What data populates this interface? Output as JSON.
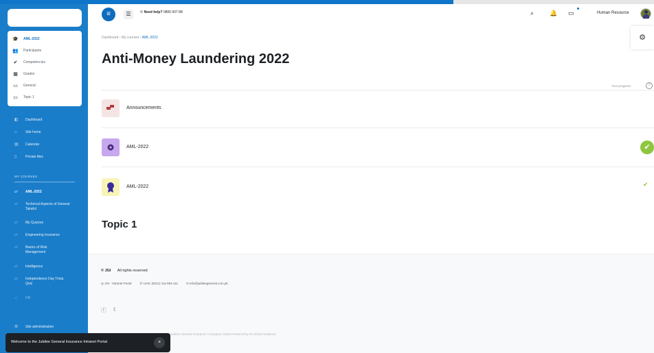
{
  "topbar": {
    "help_label": "Need help?",
    "help_phone": "0800 007 88",
    "user_name": "Human Resource",
    "icons": [
      "menu-icon",
      "list-icon",
      "phone-icon",
      "search-icon",
      "bell-icon",
      "chat-icon"
    ]
  },
  "course_index": [
    {
      "label": "AML-2022",
      "icon": "graduation-cap-icon",
      "active": true
    },
    {
      "label": "Participants",
      "icon": "users-icon"
    },
    {
      "label": "Competencies",
      "icon": "check-icon"
    },
    {
      "label": "Grades",
      "icon": "grades-icon"
    },
    {
      "label": "General",
      "icon": "folder-icon"
    },
    {
      "label": "Topic 1",
      "icon": "folder-icon"
    }
  ],
  "nav": [
    {
      "label": "Dashboard",
      "icon": "dashboard-icon"
    },
    {
      "label": "Site home",
      "icon": "home-icon"
    },
    {
      "label": "Calendar",
      "icon": "calendar-icon"
    },
    {
      "label": "Private files",
      "icon": "file-icon"
    }
  ],
  "my_courses": {
    "heading": "MY COURSES",
    "items": [
      {
        "label": "AML-2022",
        "active": true
      },
      {
        "label": "Technical Aspects of General Takaful"
      },
      {
        "label": "My Quizzes"
      },
      {
        "label": "Engineering Insurance"
      },
      {
        "label": "Basics of Risk Management"
      },
      {
        "label": "Intelligence"
      },
      {
        "label": "Independence Day Trivia Quiz"
      },
      {
        "label": "HR"
      }
    ]
  },
  "site_admin": "Site administration",
  "breadcrumb": {
    "items": [
      "Dashboard",
      "My courses",
      "AML-2022"
    ],
    "separator": "›"
  },
  "page_title": "Anti-Money Laundering 2022",
  "progress": {
    "label": "Your progress",
    "help": "?"
  },
  "activities": [
    {
      "name": "Announcements",
      "icon": "forum-icon",
      "color": "#f4e4e4",
      "completion": "none"
    },
    {
      "name": "AML-2022",
      "icon": "scorm-icon",
      "color": "#c7a7ee",
      "completion": "complete"
    },
    {
      "name": "AML-2022",
      "icon": "certificate-icon",
      "color": "#f8f4b8",
      "completion": "manual-complete"
    }
  ],
  "section_title": "Topic 1",
  "footer": {
    "brand": "© JGI",
    "rights": "All rights reserved",
    "links": [
      {
        "icon": "globe-icon",
        "label": "JGI - Intranet Portal"
      },
      {
        "icon": "phone-icon",
        "label": "UAN: (9221) 111-654-111"
      },
      {
        "icon": "mail-icon",
        "label": "info@jubileegeneral.com.pk"
      }
    ],
    "social": [
      "facebook-icon",
      "twitter-icon"
    ],
    "powered": "Jubilee General Insurance Company Limited Powered by ID Global Solutions"
  },
  "toast": {
    "text": "Welcome to the Jubilee General Insurance Intranet Portal",
    "close": "×"
  },
  "colors": {
    "sidebar": "#1a7dc9",
    "accent": "#0f6cbf",
    "complete": "#8ec63f"
  }
}
